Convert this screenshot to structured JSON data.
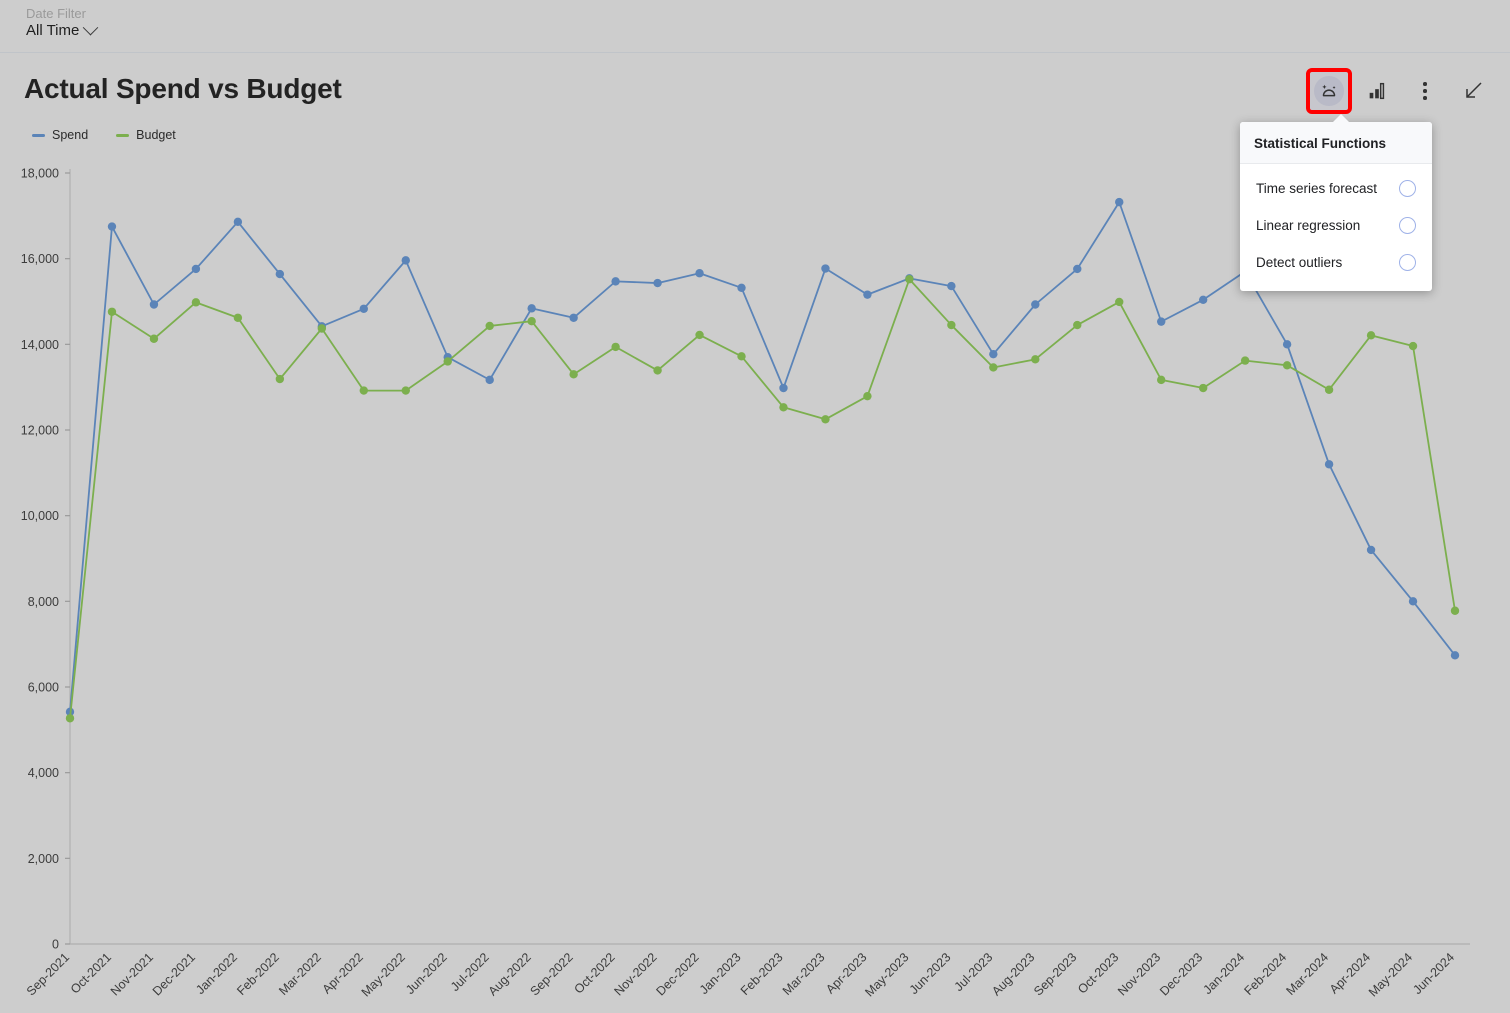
{
  "date_filter": {
    "label": "Date Filter",
    "value": "All Time",
    "chevron_icon": "chevron-down-icon"
  },
  "card": {
    "title": "Actual Spend vs Budget"
  },
  "toolbar": {
    "buttons": [
      {
        "name": "statistical-functions-button",
        "icon": "magic-stats-icon",
        "highlighted": true
      },
      {
        "name": "chart-type-button",
        "icon": "bar-chart-icon",
        "highlighted": false
      },
      {
        "name": "more-options-button",
        "icon": "kebab-menu-icon",
        "highlighted": false
      },
      {
        "name": "collapse-button",
        "icon": "arrow-down-left-icon",
        "highlighted": false
      }
    ],
    "highlight_color": "#ff0000"
  },
  "stat_panel": {
    "header": "Statistical Functions",
    "items": [
      {
        "label": "Time series forecast",
        "selected": false
      },
      {
        "label": "Linear regression",
        "selected": false
      },
      {
        "label": "Detect outliers",
        "selected": false
      }
    ]
  },
  "legend": [
    {
      "label": "Spend",
      "color": "#5b84b8"
    },
    {
      "label": "Budget",
      "color": "#7caf4e"
    }
  ],
  "chart_data": {
    "type": "line",
    "title": "Actual Spend vs Budget",
    "xlabel": "",
    "ylabel": "",
    "ylim": [
      0,
      18000
    ],
    "yticks": [
      0,
      2000,
      4000,
      6000,
      8000,
      10000,
      12000,
      14000,
      16000,
      18000
    ],
    "ytick_labels": [
      "0",
      "2,000",
      "4,000",
      "6,000",
      "8,000",
      "10,000",
      "12,000",
      "14,000",
      "16,000",
      "18,000"
    ],
    "grid": false,
    "legend_position": "top-left",
    "categories": [
      "Sep-2021",
      "Oct-2021",
      "Nov-2021",
      "Dec-2021",
      "Jan-2022",
      "Feb-2022",
      "Mar-2022",
      "Apr-2022",
      "May-2022",
      "Jun-2022",
      "Jul-2022",
      "Aug-2022",
      "Sep-2022",
      "Oct-2022",
      "Nov-2022",
      "Dec-2022",
      "Jan-2023",
      "Feb-2023",
      "Mar-2023",
      "Apr-2023",
      "May-2023",
      "Jun-2023",
      "Jul-2023",
      "Aug-2023",
      "Sep-2023",
      "Oct-2023",
      "Nov-2023",
      "Dec-2023",
      "Jan-2024",
      "Feb-2024",
      "Mar-2024",
      "Apr-2024",
      "May-2024",
      "Jun-2024"
    ],
    "series": [
      {
        "name": "Spend",
        "color": "#5b84b8",
        "values": [
          5420,
          16750,
          14930,
          15760,
          16860,
          15640,
          14420,
          14830,
          15960,
          13700,
          13170,
          14840,
          14620,
          15470,
          15430,
          15660,
          15320,
          12980,
          15770,
          15160,
          15540,
          15360,
          13770,
          14930,
          15760,
          17320,
          14530,
          15040,
          15700,
          14000,
          11200,
          9200,
          8000,
          6740
        ]
      },
      {
        "name": "Budget",
        "color": "#7caf4e",
        "values": [
          5270,
          14760,
          14130,
          14980,
          14620,
          13190,
          14370,
          12920,
          12920,
          13600,
          14430,
          14540,
          13300,
          13940,
          13390,
          14220,
          13720,
          12530,
          12250,
          12790,
          15520,
          14450,
          13460,
          13650,
          14450,
          14990,
          13170,
          12980,
          13620,
          13510,
          12940,
          14210,
          13960,
          7780
        ]
      }
    ]
  }
}
